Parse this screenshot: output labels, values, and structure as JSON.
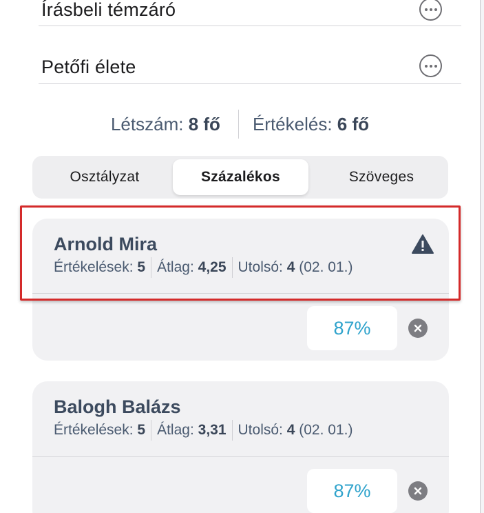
{
  "topics": [
    {
      "title": "Írásbeli témzáró",
      "more_icon": "ellipsis-circle-icon"
    },
    {
      "title": "Petőfi élete",
      "more_icon": "ellipsis-circle-icon"
    }
  ],
  "counts": {
    "headcount_label": "Létszám:",
    "headcount_value": "8 fő",
    "graded_label": "Értékelés:",
    "graded_value": "6 fő"
  },
  "segmented": {
    "options": [
      "Osztályzat",
      "Százalékos",
      "Szöveges"
    ],
    "selected": "Százalékos"
  },
  "students": [
    {
      "name": "Arnold Mira",
      "warning_icon": "warning-triangle-icon",
      "grades_label": "Értékelések:",
      "grades_count": "5",
      "average_label": "Átlag:",
      "average_value": "4,25",
      "last_label": "Utolsó:",
      "last_value": "4",
      "last_date": "(02. 01.)",
      "score": "87%",
      "clear_icon": "clear-circle-icon",
      "highlighted": true
    },
    {
      "name": "Balogh Balázs",
      "grades_label": "Értékelések:",
      "grades_count": "5",
      "average_label": "Átlag:",
      "average_value": "3,31",
      "last_label": "Utolsó:",
      "last_value": "4",
      "last_date": "(02. 01.)",
      "score": "87%",
      "clear_icon": "clear-circle-icon",
      "highlighted": false
    }
  ],
  "colors": {
    "accent": "#2fa3cc",
    "highlight_border": "#d42a2a",
    "card_bg": "#f1f1f3",
    "name_text": "#3c4a5e"
  }
}
